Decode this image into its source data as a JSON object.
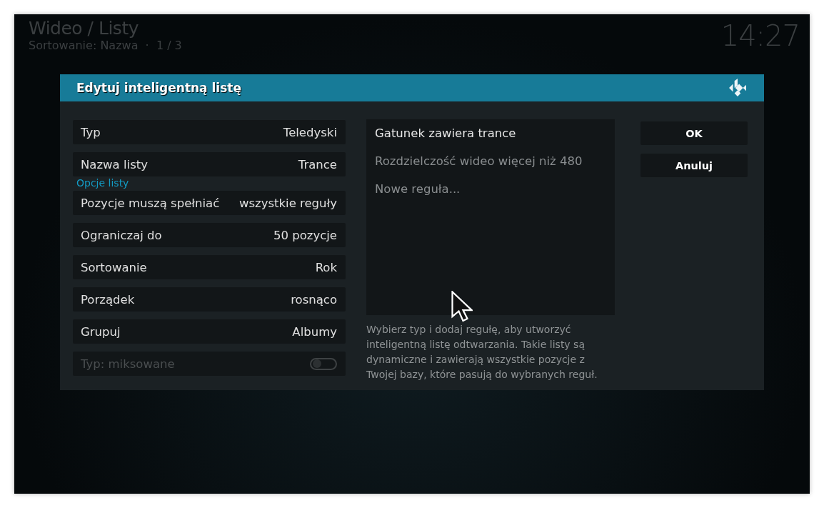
{
  "header": {
    "title": "Wideo / Listy",
    "subtitle": "Sortowanie: Nazwa  ·  1 / 3",
    "clock": "14:27"
  },
  "dialog": {
    "title": "Edytuj inteligentną listę",
    "settings": [
      {
        "kind": "value",
        "label": "Typ",
        "value": "Teledyski"
      },
      {
        "kind": "value",
        "label": "Nazwa listy",
        "value": "Trance"
      },
      {
        "kind": "section",
        "label": "Opcje listy"
      },
      {
        "kind": "value",
        "label": "Pozycje muszą spełniać",
        "value": "wszystkie reguły"
      },
      {
        "kind": "value",
        "label": "Ograniczaj do",
        "value": "50 pozycje"
      },
      {
        "kind": "value",
        "label": "Sortowanie",
        "value": "Rok"
      },
      {
        "kind": "value",
        "label": "Porządek",
        "value": "rosnąco"
      },
      {
        "kind": "value",
        "label": "Grupuj",
        "value": "Albumy"
      },
      {
        "kind": "toggle",
        "label": "Typ: miksowane",
        "on": false,
        "disabled": true
      }
    ],
    "rules": [
      {
        "label": "Gatunek zawiera trance",
        "selected": true
      },
      {
        "label": "Rozdzielczość wideo więcej niż 480",
        "selected": false
      },
      {
        "label": "Nowe reguła...",
        "selected": false
      }
    ],
    "description": "Wybierz typ i dodaj regułę, aby utworzyć inteligentną listę odtwarzania. Takie listy są dynamiczne i zawierają wszystkie pozycje z Twojej bazy, które pasują do wybranych reguł.",
    "buttons": [
      "OK",
      "Anuluj"
    ]
  }
}
